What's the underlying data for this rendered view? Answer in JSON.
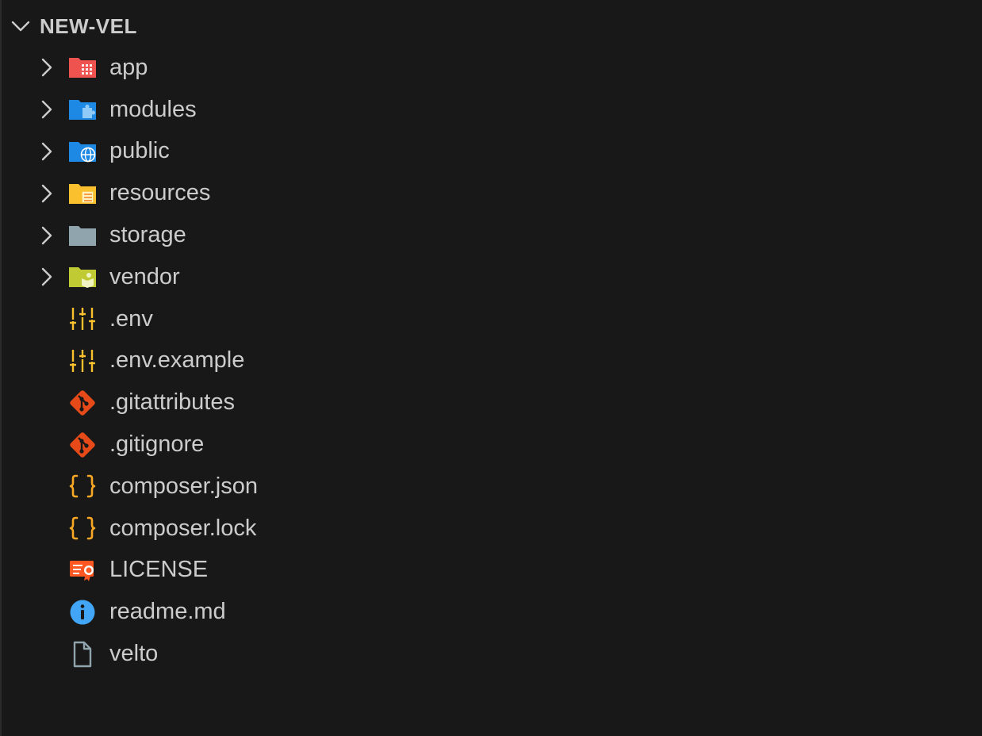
{
  "explorer": {
    "root_title": "NEW-VEL",
    "items": [
      {
        "label": "app",
        "type": "folder",
        "icon": "folder-app-icon",
        "color": "#ef5350"
      },
      {
        "label": "modules",
        "type": "folder",
        "icon": "folder-modules-icon",
        "color": "#1e88e5"
      },
      {
        "label": "public",
        "type": "folder",
        "icon": "folder-public-icon",
        "color": "#1e88e5"
      },
      {
        "label": "resources",
        "type": "folder",
        "icon": "folder-resources-icon",
        "color": "#fbc02d"
      },
      {
        "label": "storage",
        "type": "folder",
        "icon": "folder-storage-icon",
        "color": "#90a4ae"
      },
      {
        "label": "vendor",
        "type": "folder",
        "icon": "folder-vendor-icon",
        "color": "#c0ca33"
      },
      {
        "label": ".env",
        "type": "file",
        "icon": "env-settings-icon",
        "color": "#fbc02d"
      },
      {
        "label": ".env.example",
        "type": "file",
        "icon": "env-settings-icon",
        "color": "#fbc02d"
      },
      {
        "label": ".gitattributes",
        "type": "file",
        "icon": "git-icon",
        "color": "#e64a19"
      },
      {
        "label": ".gitignore",
        "type": "file",
        "icon": "git-icon",
        "color": "#e64a19"
      },
      {
        "label": "composer.json",
        "type": "file",
        "icon": "json-braces-icon",
        "color": "#f9a825"
      },
      {
        "label": "composer.lock",
        "type": "file",
        "icon": "json-braces-icon",
        "color": "#f9a825"
      },
      {
        "label": "LICENSE",
        "type": "file",
        "icon": "license-icon",
        "color": "#ff5722"
      },
      {
        "label": "readme.md",
        "type": "file",
        "icon": "info-icon",
        "color": "#42a5f5"
      },
      {
        "label": "velto",
        "type": "file",
        "icon": "file-icon",
        "color": "#90a4ae"
      }
    ]
  }
}
